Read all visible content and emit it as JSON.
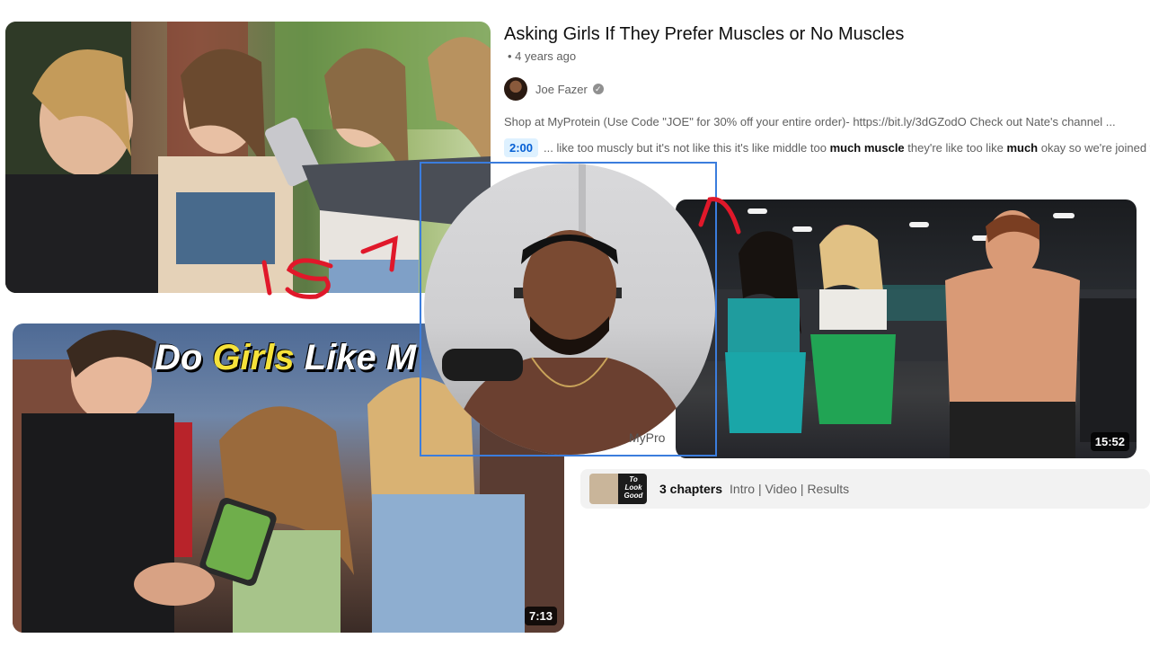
{
  "results": {
    "video": {
      "title": "Asking Girls If They Prefer Muscles or No Muscles",
      "meta": "• 4 years ago",
      "channel": "Joe Fazer",
      "description": "Shop at MyProtein (Use Code \"JOE\" for 30% off your entire order)- https://bit.ly/3dGZodO Check out Nate's channel ...",
      "snippet": {
        "timestamp": "2:00",
        "text_parts": [
          "... like too muscly but it's not like this it's like middle too ",
          "much muscle",
          " they're like too like ",
          "much",
          " okay so we're joined w"
        ]
      }
    },
    "thumbnails": {
      "night_title_part1": "Do ",
      "night_title_part2": "Girls",
      "night_title_part3": " Like M",
      "night_duration": "7:13",
      "gym_duration": "15:52"
    },
    "chapters": {
      "thumb_text": "To Look Good",
      "count": "3 chapters",
      "list": "Intro | Video | Results"
    },
    "webcam_label": "MyPro"
  },
  "colors": {
    "accent_blue": "#065fd4",
    "webcam_border": "#3b7ddd",
    "annotation_red": "#e0182a"
  }
}
